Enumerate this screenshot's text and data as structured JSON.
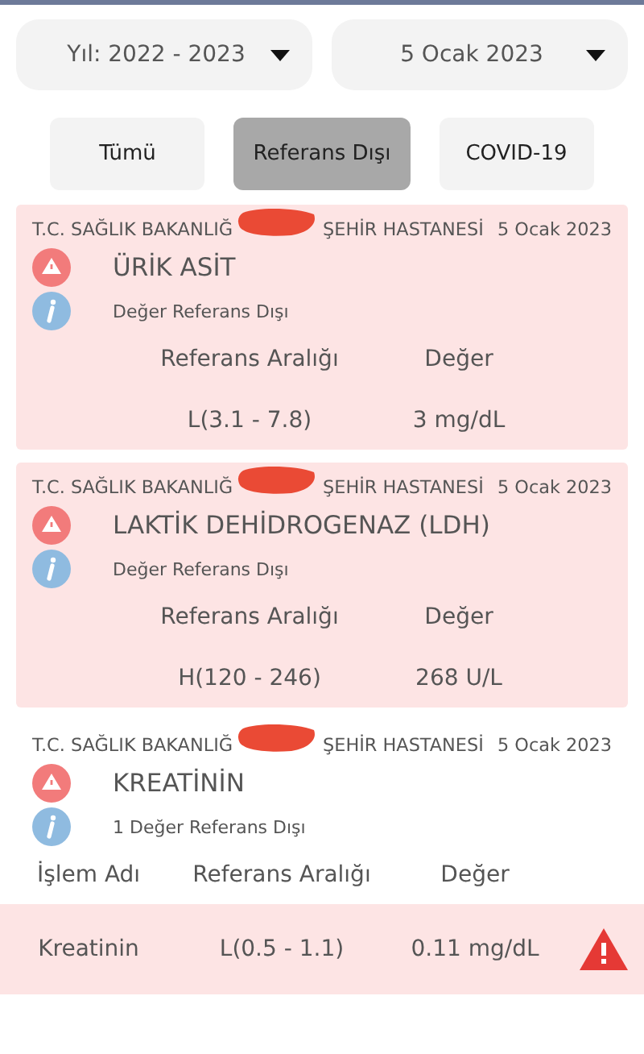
{
  "filters": {
    "year": "Yıl: 2022 - 2023",
    "date": "5 Ocak 2023"
  },
  "tabs": [
    {
      "label": "Tümü",
      "selected": false
    },
    {
      "label": "Referans Dışı",
      "selected": true
    },
    {
      "label": "COVID-19",
      "selected": false
    }
  ],
  "results": [
    {
      "kind": "single",
      "out_of_range": true,
      "hospital_start": "T.C. SAĞLIK BAKANLIĞ",
      "hospital_end": "ŞEHİR HASTANESİ",
      "date": "5 Ocak 2023",
      "name": "ÜRİK ASİT",
      "note": "Değer Referans Dışı",
      "headers": [
        "Referans Aralığı",
        "Değer"
      ],
      "rows": [
        {
          "range": "L(3.1 - 7.8)",
          "value": "3 mg/dL"
        }
      ]
    },
    {
      "kind": "single",
      "out_of_range": true,
      "hospital_start": "T.C. SAĞLIK BAKANLIĞ",
      "hospital_end": "ŞEHİR HASTANESİ",
      "date": "5 Ocak 2023",
      "name": "LAKTİK DEHİDROGENAZ (LDH)",
      "note": "Değer Referans Dışı",
      "headers": [
        "Referans Aralığı",
        "Değer"
      ],
      "rows": [
        {
          "range": "H(120 - 246)",
          "value": "268 U/L"
        }
      ]
    },
    {
      "kind": "group",
      "out_of_range": false,
      "hospital_start": "T.C. SAĞLIK BAKANLIĞ",
      "hospital_end": "ŞEHİR HASTANESİ",
      "date": "5 Ocak 2023",
      "name": "KREATİNİN",
      "note": "1 Değer Referans Dışı",
      "headers": [
        "İşlem Adı",
        "Referans Aralığı",
        "Değer"
      ],
      "rows": [
        {
          "name": "Kreatinin",
          "range": "L(0.5 - 1.1)",
          "value": "0.11 mg/dL",
          "out_of_range": true
        }
      ]
    }
  ]
}
